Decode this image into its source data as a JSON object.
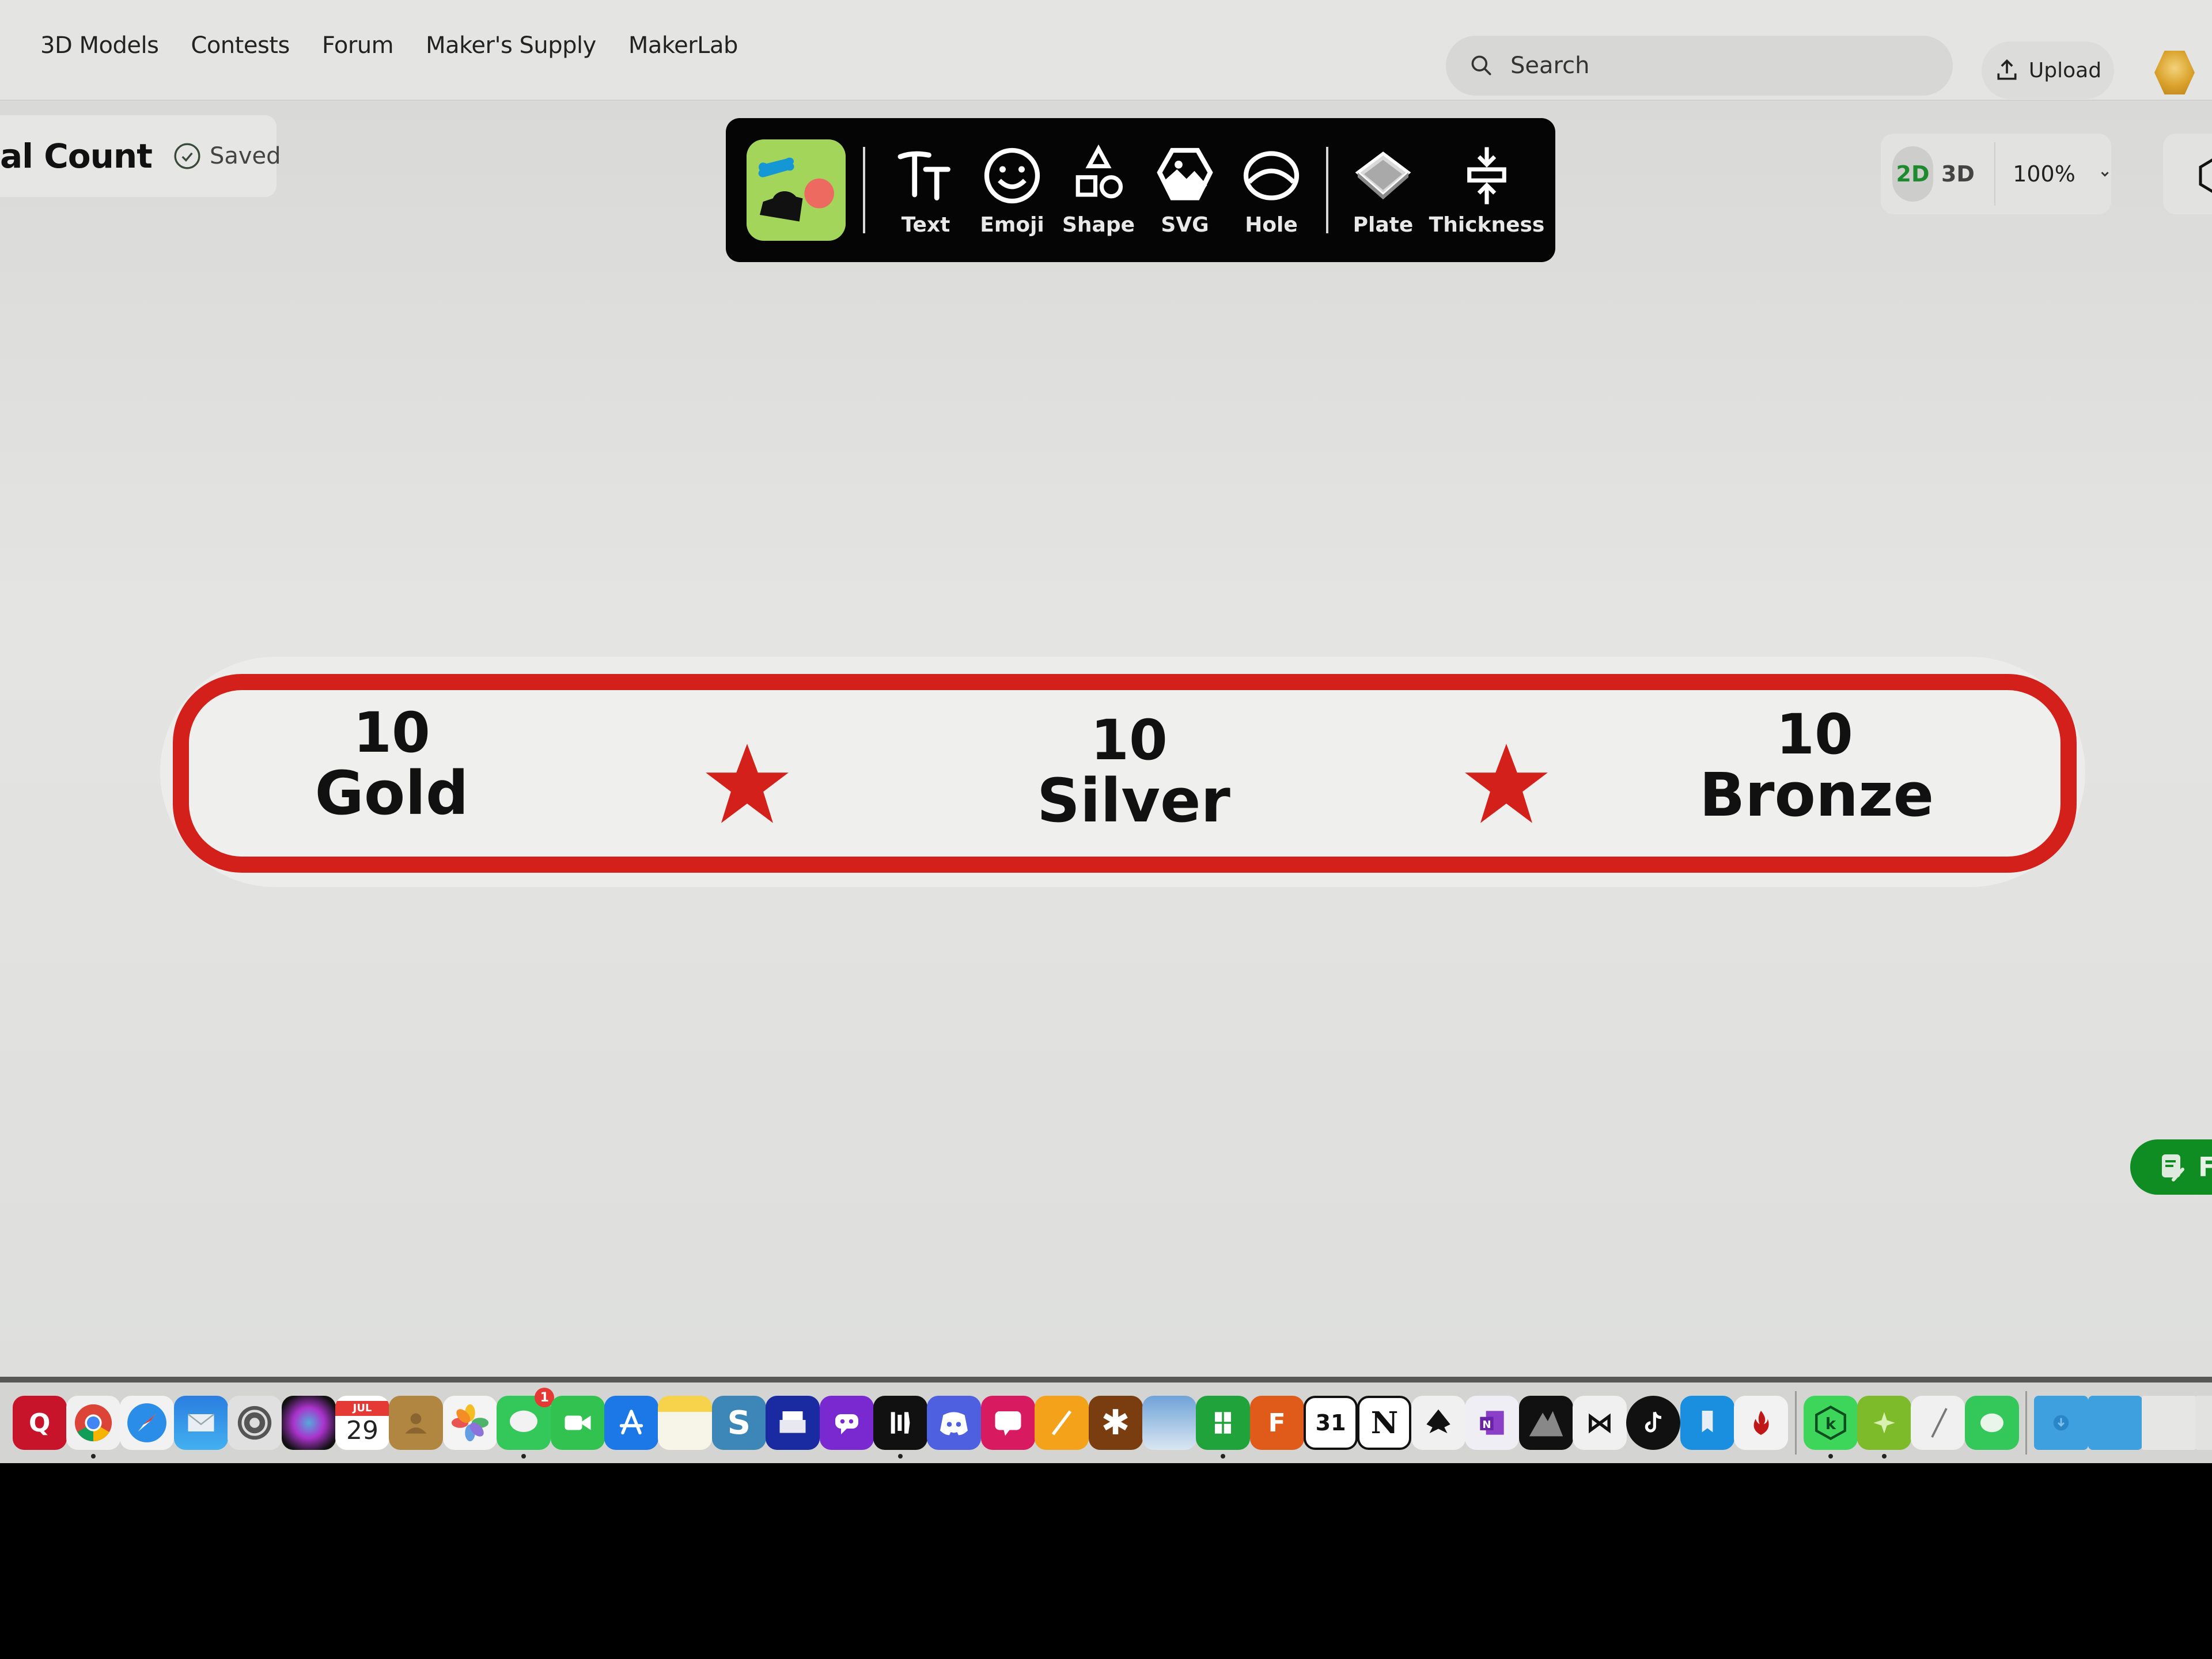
{
  "nav": {
    "links": [
      "3D Models",
      "Contests",
      "Forum",
      "Maker's Supply",
      "MakerLab"
    ],
    "search_placeholder": "Search",
    "upload_label": "Upload"
  },
  "project": {
    "title": "al Count",
    "status": "Saved"
  },
  "toolbar": {
    "items": [
      {
        "label": "Text",
        "icon": "text-icon"
      },
      {
        "label": "Emoji",
        "icon": "emoji-icon"
      },
      {
        "label": "Shape",
        "icon": "shape-icon"
      },
      {
        "label": "SVG",
        "icon": "svg-icon"
      },
      {
        "label": "Hole",
        "icon": "hole-icon"
      },
      {
        "label": "Plate",
        "icon": "plate-icon"
      },
      {
        "label": "Thickness",
        "icon": "thickness-icon"
      }
    ]
  },
  "view": {
    "mode_2d": "2D",
    "mode_3d": "3D",
    "active_mode": "2D",
    "zoom": "100%"
  },
  "plate": {
    "border_color": "#d4201a",
    "items": [
      {
        "count": "10",
        "label": "Gold"
      },
      {
        "count": "10",
        "label": "Silver"
      },
      {
        "count": "10",
        "label": "Bronze"
      }
    ],
    "star_color": "#d4201a"
  },
  "float_button": {
    "label": "F"
  },
  "dock": {
    "calendar_month": "JUL",
    "calendar_day": "29",
    "messages_badge": "1",
    "apps": [
      "app-red-q",
      "chrome",
      "safari",
      "mail",
      "system-settings",
      "siri",
      "calendar",
      "contacts",
      "photos",
      "messages",
      "facetime",
      "app-store",
      "notes",
      "app-s",
      "scanner",
      "chat-bot",
      "app-dark",
      "discord",
      "call-app",
      "pages-pen",
      "app-asterisk",
      "preview",
      "numbers",
      "fusion",
      "calendar-31",
      "notion",
      "inkscape",
      "onenote",
      "monavue-go",
      "capcut",
      "tiktok",
      "bookmark-app",
      "flame-app",
      "kaspersky",
      "green-app",
      "textedit",
      "imessage-alt",
      "downloads-folder",
      "folder",
      "blank-doc",
      "blank-doc-2"
    ]
  }
}
